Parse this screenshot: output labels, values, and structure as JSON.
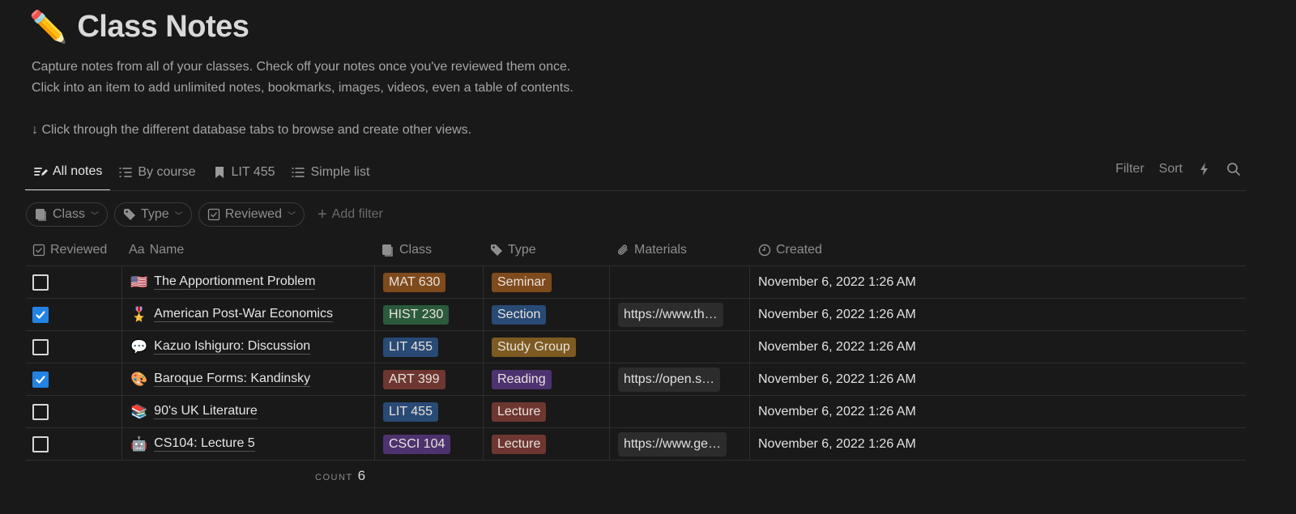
{
  "page": {
    "emoji": "✏️",
    "title": "Class Notes",
    "description": [
      "Capture notes from all of your classes. Check off your notes once you've reviewed them once.",
      "Click into an item to add unlimited notes, bookmarks, images, videos, even a table of contents.",
      "",
      "↓ Click through the different database tabs to browse and create other views."
    ]
  },
  "tabs": [
    {
      "label": "All notes",
      "icon": "edit-list-icon",
      "active": true
    },
    {
      "label": "By course",
      "icon": "grouped-list-icon",
      "active": false
    },
    {
      "label": "LIT 455",
      "icon": "bookmark-icon",
      "active": false
    },
    {
      "label": "Simple list",
      "icon": "list-icon",
      "active": false
    }
  ],
  "toolbar": {
    "filter_label": "Filter",
    "sort_label": "Sort",
    "automation_icon": "lightning-icon",
    "search_icon": "search-icon"
  },
  "filters": [
    {
      "label": "Class",
      "icon": "grade-icon"
    },
    {
      "label": "Type",
      "icon": "tag-icon"
    },
    {
      "label": "Reviewed",
      "icon": "checkbox-icon"
    }
  ],
  "add_filter_label": "Add filter",
  "table": {
    "columns": [
      {
        "label": "Reviewed",
        "icon": "checkbox-icon"
      },
      {
        "label": "Name",
        "icon": "text-icon",
        "icon_text": "Aa"
      },
      {
        "label": "Class",
        "icon": "grade-icon"
      },
      {
        "label": "Type",
        "icon": "tag-icon"
      },
      {
        "label": "Materials",
        "icon": "paperclip-icon"
      },
      {
        "label": "Created",
        "icon": "clock-icon"
      }
    ],
    "rows": [
      {
        "reviewed": false,
        "emoji": "🇺🇸",
        "name": "The Apportionment Problem",
        "class": "MAT 630",
        "class_color": "#7f4a1c",
        "type": "Seminar",
        "type_color": "#7f4a1c",
        "materials": "",
        "created": "November 6, 2022 1:26 AM"
      },
      {
        "reviewed": true,
        "emoji": "🎖️",
        "name": "American Post-War Economics",
        "class": "HIST 230",
        "class_color": "#2b5a3d",
        "type": "Section",
        "type_color": "#284a75",
        "materials": "https://www.th…",
        "created": "November 6, 2022 1:26 AM"
      },
      {
        "reviewed": false,
        "emoji": "💬",
        "name": "Kazuo Ishiguro: Discussion",
        "class": "LIT 455",
        "class_color": "#284a75",
        "type": "Study Group",
        "type_color": "#7d5a22",
        "materials": "",
        "created": "November 6, 2022 1:26 AM"
      },
      {
        "reviewed": true,
        "emoji": "🎨",
        "name": "Baroque Forms: Kandinsky",
        "class": "ART 399",
        "class_color": "#6e3630",
        "type": "Reading",
        "type_color": "#4d3270",
        "materials": "https://open.s…",
        "created": "November 6, 2022 1:26 AM"
      },
      {
        "reviewed": false,
        "emoji": "📚",
        "name": "90's UK Literature",
        "class": "LIT 455",
        "class_color": "#284a75",
        "type": "Lecture",
        "type_color": "#6e3630",
        "materials": "",
        "created": "November 6, 2022 1:26 AM"
      },
      {
        "reviewed": false,
        "emoji": "🤖",
        "name": "CS104: Lecture 5",
        "class": "CSCI 104",
        "class_color": "#4d3270",
        "type": "Lecture",
        "type_color": "#6e3630",
        "materials": "https://www.ge…",
        "created": "November 6, 2022 1:26 AM"
      }
    ]
  },
  "footer": {
    "count_label": "COUNT",
    "count_value": "6"
  }
}
